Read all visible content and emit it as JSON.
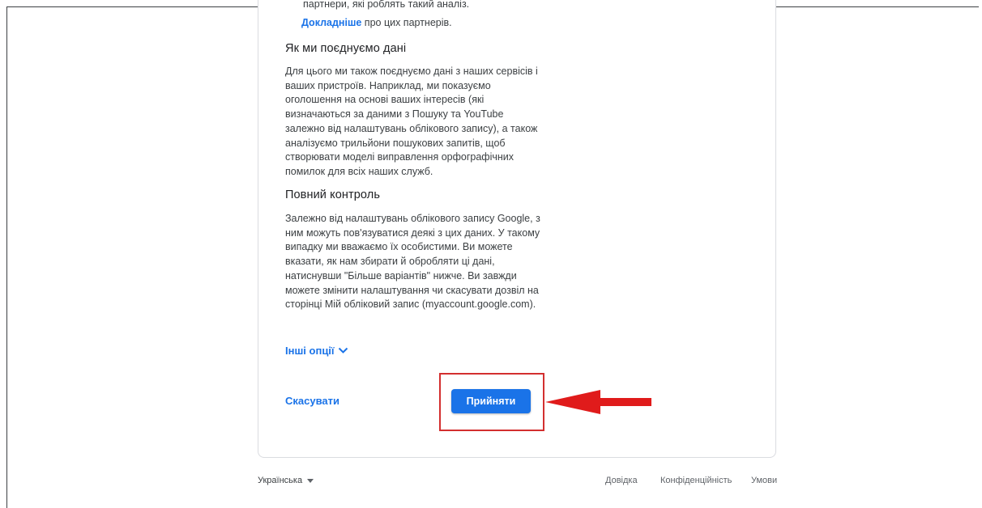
{
  "consent": {
    "clipped_line": "партнери, які роблять такий аналіз.",
    "learn_more": {
      "link": "Докладніше",
      "rest": " про цих партнерів."
    },
    "sections": [
      {
        "heading": "Як ми поєднуємо дані",
        "body": "Для цього ми також поєднуємо дані з наших сервісів і ваших пристроїв. Наприклад, ми показуємо оголошення на основі ваших інтересів (які визначаються за даними з Пошуку та YouTube залежно від налаштувань облікового запису), а також аналізуємо трильйони пошукових запитів, щоб створювати моделі виправлення орфографічних помилок для всіх наших служб."
      },
      {
        "heading": "Повний контроль",
        "body": "Залежно від налаштувань облікового запису Google, з ним можуть пов'язуватися деякі з цих даних. У такому випадку ми вважаємо їх особистими. Ви можете вказати, як нам збирати й обробляти ці дані, натиснувши \"Більше варіантів\" нижче. Ви завжди можете змінити налаштування чи скасувати дозвіл на сторінці Мій обліковий запис (myaccount.google.com)."
      }
    ],
    "more_options": "Інші опції",
    "cancel_label": "Скасувати",
    "accept_label": "Прийняти"
  },
  "footer": {
    "language": "Українська",
    "links": [
      "Довідка",
      "Конфіденційність",
      "Умови"
    ]
  },
  "colors": {
    "accent": "#1a73e8",
    "annotation": "#d32f2f"
  },
  "icons": {
    "more_options": "chevron-down-icon",
    "language": "caret-down-icon",
    "annotation": "red-arrow-icon"
  }
}
